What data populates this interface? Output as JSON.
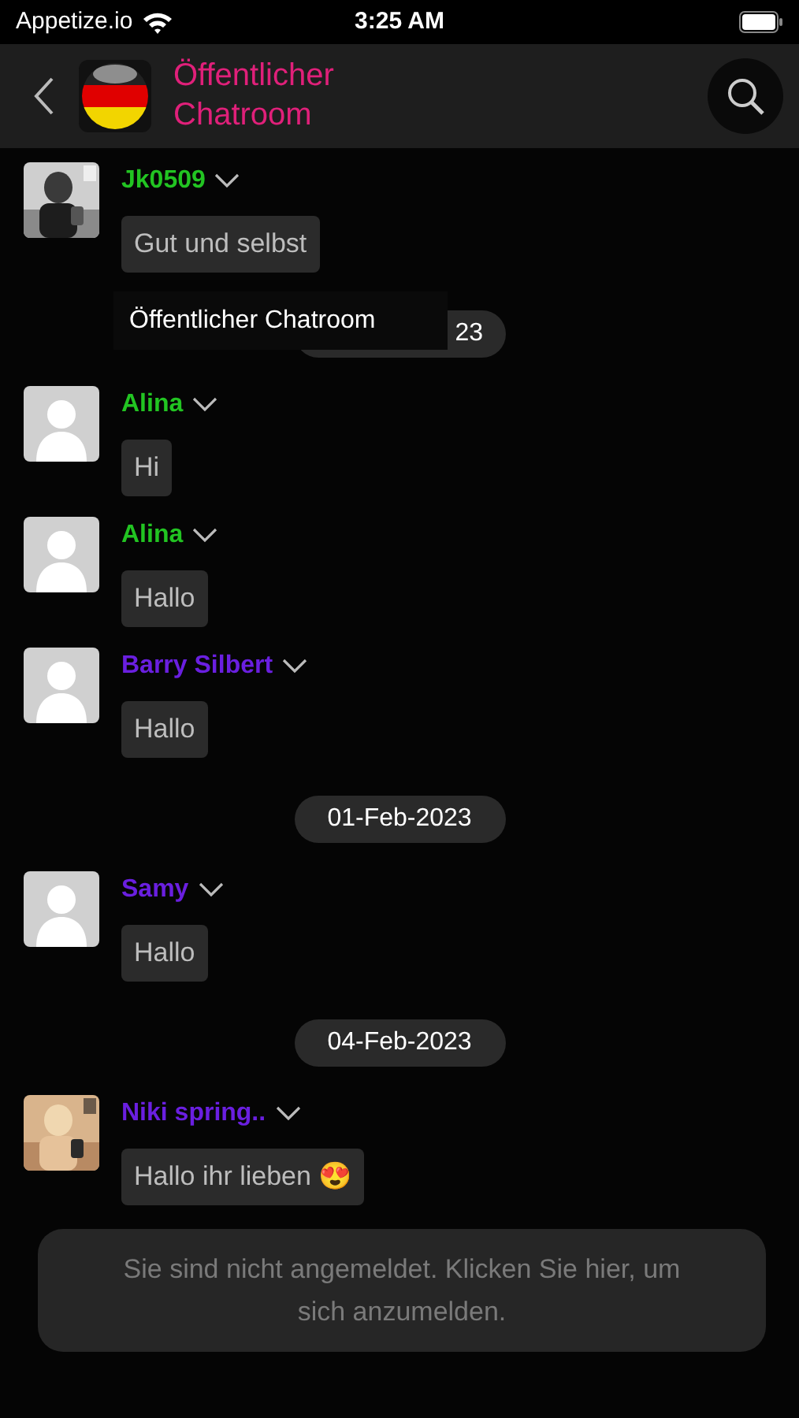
{
  "status_bar": {
    "carrier": "Appetize.io",
    "time": "3:25 AM"
  },
  "header": {
    "title": "Öffentlicher Chatroom"
  },
  "tooltip": {
    "text": "Öffentlicher Chatroom"
  },
  "feed": [
    {
      "kind": "message",
      "has_photo": true,
      "name": "Jk0509",
      "color": "#22c422",
      "text": "Gut und selbst"
    },
    {
      "kind": "date",
      "text": "23"
    },
    {
      "kind": "message",
      "has_photo": false,
      "name": "Alina",
      "color": "#22c422",
      "text": "Hi"
    },
    {
      "kind": "message",
      "has_photo": false,
      "name": "Alina",
      "color": "#22c422",
      "text": "Hallo"
    },
    {
      "kind": "message",
      "has_photo": false,
      "name": "Barry Silbert",
      "color": "#6a1fe0",
      "text": "Hallo"
    },
    {
      "kind": "date",
      "text": "01-Feb-2023"
    },
    {
      "kind": "message",
      "has_photo": false,
      "name": "Samy",
      "color": "#6a1fe0",
      "text": "Hallo"
    },
    {
      "kind": "date",
      "text": "04-Feb-2023"
    },
    {
      "kind": "message",
      "has_photo": true,
      "name": "Niki spring..",
      "color": "#6a1fe0",
      "text": "Hallo ihr lieben 😍"
    }
  ],
  "login_prompt": {
    "text": "Sie sind nicht angemeldet. Klicken Sie hier, um sich anzumelden."
  }
}
